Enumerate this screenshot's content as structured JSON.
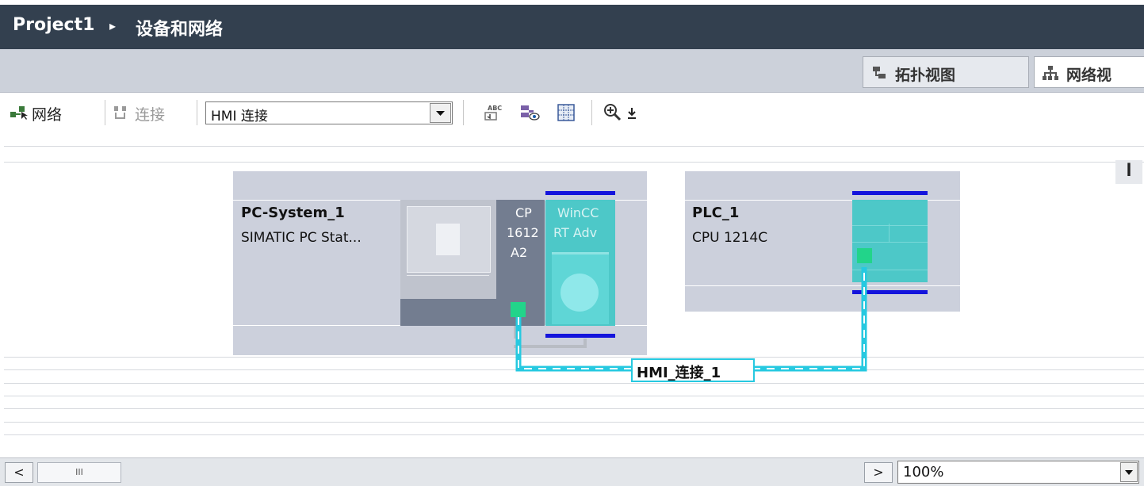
{
  "title_bar": {
    "project": "Project1",
    "separator": "▸",
    "page": "设备和网络"
  },
  "view_tabs": {
    "topology": "拓扑视图",
    "network": "网络视"
  },
  "toolbar": {
    "network_label": "网络",
    "connections_label": "连接",
    "connection_type": "HMI 连接"
  },
  "devices": [
    {
      "name": "PC-System_1",
      "type": "SIMATIC PC Stat...",
      "cp_module": [
        "CP",
        "1612",
        "A2"
      ],
      "runtime": [
        "WinCC",
        "RT Adv"
      ]
    },
    {
      "name": "PLC_1",
      "type": "CPU 1214C"
    }
  ],
  "connection": {
    "label": "HMI_连接_1",
    "color": "#26c9e0"
  },
  "bottom": {
    "scroll_left": "<",
    "scroll_thumb": "III",
    "scroll_right": ">",
    "zoom": "100%"
  },
  "colors": {
    "title_bg": "#33404f",
    "device_bg": "#ccd0dc",
    "module_teal": "#4dc8c8",
    "rail_blue": "#1414dc"
  }
}
